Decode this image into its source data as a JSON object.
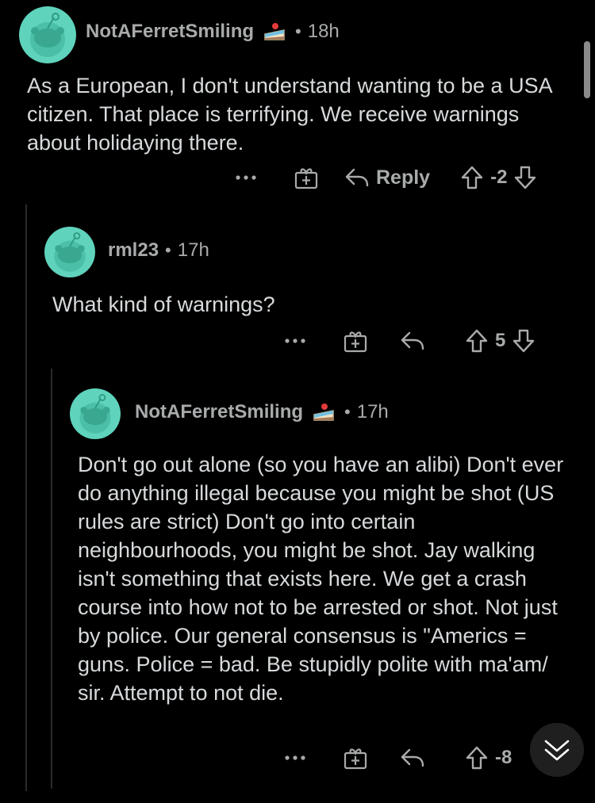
{
  "comments": [
    {
      "username": "NotAFerretSmiling",
      "has_cake": true,
      "time": "18h",
      "body": "As a European, I don't understand wanting to be a USA citizen. That place is terrifying.  We receive warnings about holidaying there.",
      "reply_label": "Reply",
      "score": "-2"
    },
    {
      "username": "rml23",
      "has_cake": false,
      "time": "17h",
      "body": "What kind of warnings?",
      "score": "5"
    },
    {
      "username": "NotAFerretSmiling",
      "has_cake": true,
      "time": "17h",
      "body": "Don't go out alone (so you have an alibi) Don't ever do anything illegal because you might be shot (US rules are strict) Don't go into certain neighbourhoods, you might be shot. Jay walking isn't something that exists here. We get a crash course into how not to be arrested or shot. Not just by police. Our general consensus is \"Americs = guns. Police = bad. Be stupidly polite with ma'am/ sir. Attempt to not die.",
      "score": "-8"
    }
  ],
  "colors": {
    "background": "#000000",
    "avatar": "#5fd3bc",
    "meta_text": "#a8aaab",
    "body_text": "#d7dadc"
  },
  "icons": {
    "more": "more-options-icon",
    "award": "award-icon",
    "reply": "reply-arrow-icon",
    "upvote": "upvote-icon",
    "downvote": "downvote-icon",
    "collapse": "chevron-double-down-icon"
  }
}
